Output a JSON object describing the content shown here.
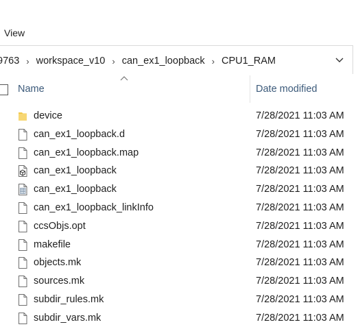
{
  "ribbon": {
    "view_tab": "View"
  },
  "address": {
    "crumbs": [
      "9763",
      "workspace_v10",
      "can_ex1_loopback",
      "CPU1_RAM"
    ],
    "separator": "›"
  },
  "columns": {
    "name": "Name",
    "date_modified": "Date modified"
  },
  "files": [
    {
      "name": "device",
      "date": "7/28/2021 11:03 AM",
      "icon": "folder-icon"
    },
    {
      "name": "can_ex1_loopback.d",
      "date": "7/28/2021 11:03 AM",
      "icon": "file-icon"
    },
    {
      "name": "can_ex1_loopback.map",
      "date": "7/28/2021 11:03 AM",
      "icon": "file-icon"
    },
    {
      "name": "can_ex1_loopback",
      "date": "7/28/2021 11:03 AM",
      "icon": "executable-file-icon"
    },
    {
      "name": "can_ex1_loopback",
      "date": "7/28/2021 11:03 AM",
      "icon": "spreadsheet-file-icon"
    },
    {
      "name": "can_ex1_loopback_linkInfo",
      "date": "7/28/2021 11:03 AM",
      "icon": "file-icon"
    },
    {
      "name": "ccsObjs.opt",
      "date": "7/28/2021 11:03 AM",
      "icon": "file-icon"
    },
    {
      "name": "makefile",
      "date": "7/28/2021 11:03 AM",
      "icon": "file-icon"
    },
    {
      "name": "objects.mk",
      "date": "7/28/2021 11:03 AM",
      "icon": "file-icon"
    },
    {
      "name": "sources.mk",
      "date": "7/28/2021 11:03 AM",
      "icon": "file-icon"
    },
    {
      "name": "subdir_rules.mk",
      "date": "7/28/2021 11:03 AM",
      "icon": "file-icon"
    },
    {
      "name": "subdir_vars.mk",
      "date": "7/28/2021 11:03 AM",
      "icon": "file-icon"
    }
  ],
  "colors": {
    "header_text": "#3c5a7a",
    "folder": "#f2c94c"
  }
}
